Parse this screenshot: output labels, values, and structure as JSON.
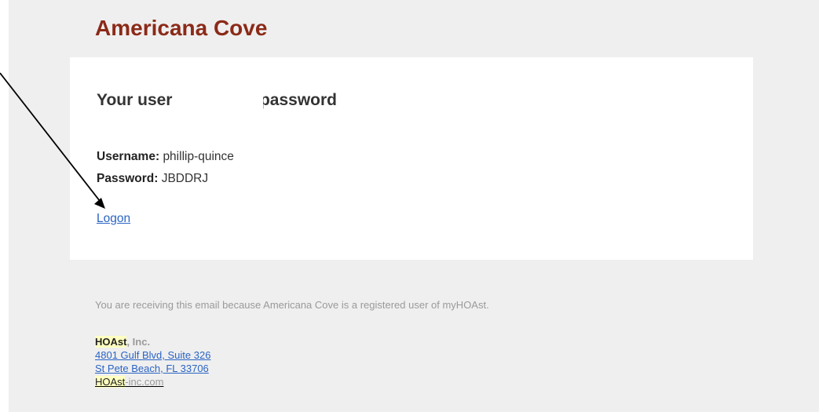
{
  "header": {
    "brand": "Americana Cove"
  },
  "card": {
    "heading_left": "Your user",
    "heading_right": "nd password",
    "username_label": "Username:",
    "username_value": "phillip-quince",
    "password_label": "Password:",
    "password_value": "JBDDRJ",
    "logon_link": "Logon"
  },
  "footer": {
    "note": "You are receiving this email because Americana Cove is a registered user of myHOAst.",
    "company_highlight": "HOAst",
    "company_suffix": ", Inc.",
    "address_line1": "4801 Gulf Blvd, Suite 326",
    "address_line2": "St Pete Beach, FL 33706",
    "site_highlight": "HOAst",
    "site_rest": "-inc.com"
  },
  "annotation": {
    "arrow_icon": "black-pointer-arrow"
  },
  "colors": {
    "brand": "#8b2a18",
    "link": "#2a64c5",
    "background": "#efefef",
    "highlight": "#ffffc0"
  }
}
